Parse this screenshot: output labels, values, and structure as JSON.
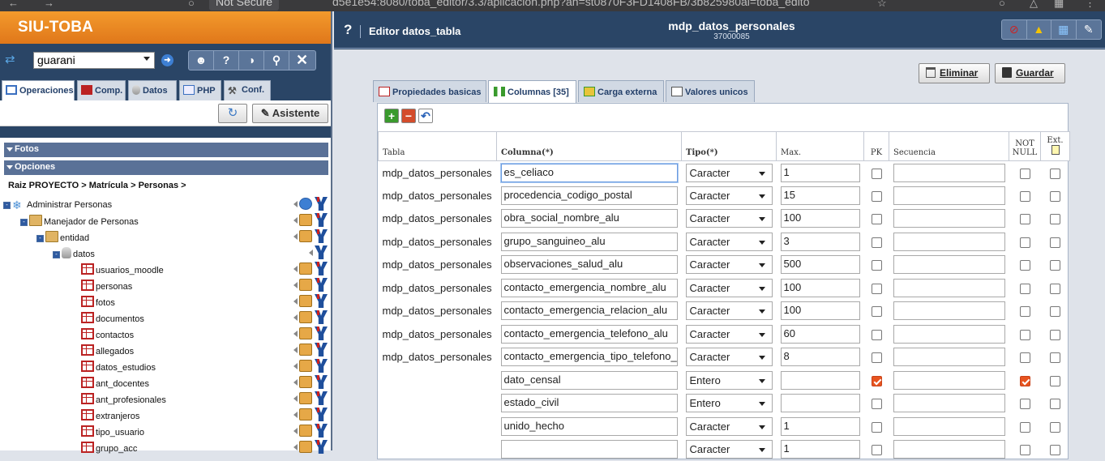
{
  "browser": {
    "url_label": "Not Secure",
    "url_text": "d5e1e54:8080/toba_editor/3.3/aplicacion.php?ah=st0870F3FD1408FB/3b825980ai=toba_edito"
  },
  "left": {
    "brand": "SIU-TOBA",
    "project": "guarani",
    "tabs": [
      {
        "label": "Operaciones"
      },
      {
        "label": "Comp."
      },
      {
        "label": "Datos"
      },
      {
        "label": "PHP"
      },
      {
        "label": "Conf."
      }
    ],
    "assistant_label": "Asistente",
    "sections": [
      "Fotos",
      "Opciones"
    ],
    "breadcrumb": "Raiz PROYECTO > Matrícula > Personas >",
    "tree": [
      {
        "label": "Administrar Personas"
      },
      {
        "label": "Manejador de Personas"
      },
      {
        "label": "entidad"
      },
      {
        "label": "datos"
      },
      {
        "label": "usuarios_moodle"
      },
      {
        "label": "personas"
      },
      {
        "label": "fotos"
      },
      {
        "label": "documentos"
      },
      {
        "label": "contactos"
      },
      {
        "label": "allegados"
      },
      {
        "label": "datos_estudios"
      },
      {
        "label": "ant_docentes"
      },
      {
        "label": "ant_profesionales"
      },
      {
        "label": "extranjeros"
      },
      {
        "label": "tipo_usuario"
      },
      {
        "label": "grupo_acc"
      }
    ]
  },
  "right": {
    "help": "?",
    "editor_title": "Editor datos_tabla",
    "object_name": "mdp_datos_personales",
    "object_id": "37000085",
    "eliminar_label": "Eliminar",
    "guardar_label": "Guardar",
    "tabs": [
      {
        "label": "Propiedades basicas"
      },
      {
        "label": "Columnas [35]"
      },
      {
        "label": "Carga externa"
      },
      {
        "label": "Valores unicos"
      }
    ],
    "headers": {
      "tabla": "Tabla",
      "columna": "Columna(*)",
      "tipo": "Tipo(*)",
      "max": "Max.",
      "pk": "PK",
      "secuencia": "Secuencia",
      "not_null": "NOT NULL",
      "ext": "Ext."
    },
    "rows": [
      {
        "tabla": "mdp_datos_personales",
        "columna": "es_celiaco",
        "tipo": "Caracter",
        "max": "1",
        "pk": false,
        "secuencia": "",
        "not_null": false,
        "ext": false
      },
      {
        "tabla": "mdp_datos_personales",
        "columna": "procedencia_codigo_postal",
        "tipo": "Caracter",
        "max": "15",
        "pk": false,
        "secuencia": "",
        "not_null": false,
        "ext": false
      },
      {
        "tabla": "mdp_datos_personales",
        "columna": "obra_social_nombre_alu",
        "tipo": "Caracter",
        "max": "100",
        "pk": false,
        "secuencia": "",
        "not_null": false,
        "ext": false
      },
      {
        "tabla": "mdp_datos_personales",
        "columna": "grupo_sanguineo_alu",
        "tipo": "Caracter",
        "max": "3",
        "pk": false,
        "secuencia": "",
        "not_null": false,
        "ext": false
      },
      {
        "tabla": "mdp_datos_personales",
        "columna": "observaciones_salud_alu",
        "tipo": "Caracter",
        "max": "500",
        "pk": false,
        "secuencia": "",
        "not_null": false,
        "ext": false
      },
      {
        "tabla": "mdp_datos_personales",
        "columna": "contacto_emergencia_nombre_alu",
        "tipo": "Caracter",
        "max": "100",
        "pk": false,
        "secuencia": "",
        "not_null": false,
        "ext": false
      },
      {
        "tabla": "mdp_datos_personales",
        "columna": "contacto_emergencia_relacion_alu",
        "tipo": "Caracter",
        "max": "100",
        "pk": false,
        "secuencia": "",
        "not_null": false,
        "ext": false
      },
      {
        "tabla": "mdp_datos_personales",
        "columna": "contacto_emergencia_telefono_alu",
        "tipo": "Caracter",
        "max": "60",
        "pk": false,
        "secuencia": "",
        "not_null": false,
        "ext": false
      },
      {
        "tabla": "mdp_datos_personales",
        "columna": "contacto_emergencia_tipo_telefono_",
        "tipo": "Caracter",
        "max": "8",
        "pk": false,
        "secuencia": "",
        "not_null": false,
        "ext": false
      },
      {
        "tabla": "",
        "columna": "dato_censal",
        "tipo": "Entero",
        "max": "",
        "pk": true,
        "secuencia": "",
        "not_null": true,
        "ext": false
      },
      {
        "tabla": "",
        "columna": "estado_civil",
        "tipo": "Entero",
        "max": "",
        "pk": false,
        "secuencia": "",
        "not_null": false,
        "ext": false
      },
      {
        "tabla": "",
        "columna": "unido_hecho",
        "tipo": "Caracter",
        "max": "1",
        "pk": false,
        "secuencia": "",
        "not_null": false,
        "ext": false
      },
      {
        "tabla": "",
        "columna": "",
        "tipo": "Caracter",
        "max": "1",
        "pk": false,
        "secuencia": "",
        "not_null": false,
        "ext": false
      }
    ]
  },
  "colors": {
    "accent_orange": "#e0771a",
    "navy": "#2a4566",
    "checked": "#e8541f"
  }
}
